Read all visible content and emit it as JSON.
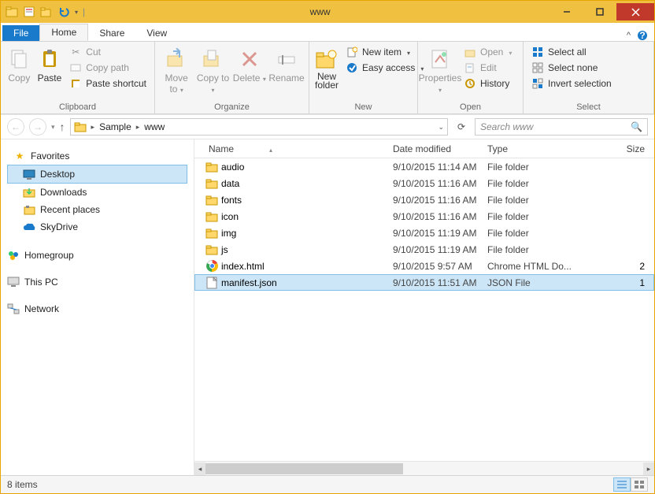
{
  "window": {
    "title": "www"
  },
  "tabs": {
    "file": "File",
    "home": "Home",
    "share": "Share",
    "view": "View"
  },
  "ribbon": {
    "clipboard": {
      "label": "Clipboard",
      "copy": "Copy",
      "paste": "Paste",
      "cut": "Cut",
      "copy_path": "Copy path",
      "paste_shortcut": "Paste shortcut"
    },
    "organize": {
      "label": "Organize",
      "move_to": "Move to",
      "copy_to": "Copy to",
      "delete": "Delete",
      "rename": "Rename"
    },
    "new": {
      "label": "New",
      "new_folder": "New folder",
      "new_item": "New item",
      "easy_access": "Easy access"
    },
    "open": {
      "label": "Open",
      "properties": "Properties",
      "open": "Open",
      "edit": "Edit",
      "history": "History"
    },
    "select": {
      "label": "Select",
      "all": "Select all",
      "none": "Select none",
      "invert": "Invert selection"
    }
  },
  "breadcrumb": {
    "root": "Sample",
    "leaf": "www"
  },
  "search": {
    "placeholder": "Search www"
  },
  "navpane": {
    "favorites": "Favorites",
    "desktop": "Desktop",
    "downloads": "Downloads",
    "recent": "Recent places",
    "skydrive": "SkyDrive",
    "homegroup": "Homegroup",
    "thispc": "This PC",
    "network": "Network"
  },
  "columns": {
    "name": "Name",
    "date": "Date modified",
    "type": "Type",
    "size": "Size"
  },
  "files": [
    {
      "icon": "folder",
      "name": "audio",
      "date": "9/10/2015 11:14 AM",
      "type": "File folder",
      "size": ""
    },
    {
      "icon": "folder",
      "name": "data",
      "date": "9/10/2015 11:16 AM",
      "type": "File folder",
      "size": ""
    },
    {
      "icon": "folder",
      "name": "fonts",
      "date": "9/10/2015 11:16 AM",
      "type": "File folder",
      "size": ""
    },
    {
      "icon": "folder",
      "name": "icon",
      "date": "9/10/2015 11:16 AM",
      "type": "File folder",
      "size": ""
    },
    {
      "icon": "folder",
      "name": "img",
      "date": "9/10/2015 11:19 AM",
      "type": "File folder",
      "size": ""
    },
    {
      "icon": "folder",
      "name": "js",
      "date": "9/10/2015 11:19 AM",
      "type": "File folder",
      "size": ""
    },
    {
      "icon": "chrome",
      "name": "index.html",
      "date": "9/10/2015 9:57 AM",
      "type": "Chrome HTML Do...",
      "size": "2"
    },
    {
      "icon": "file",
      "name": "manifest.json",
      "date": "9/10/2015 11:51 AM",
      "type": "JSON File",
      "size": "1",
      "selected": true
    }
  ],
  "status": {
    "count": "8 items"
  }
}
